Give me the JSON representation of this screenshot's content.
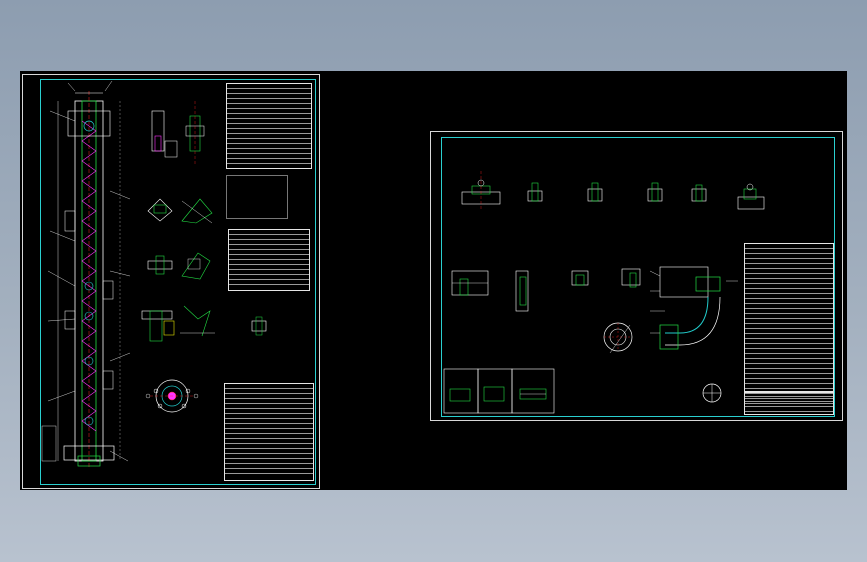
{
  "viewer": {
    "background_top": "#8d9db0",
    "background_bottom": "#b8c2cf",
    "canvas_color": "#000000"
  },
  "colors": {
    "frame": "#2ad0d0",
    "sheet_border": "#d8d8d8",
    "line_white": "#ffffff",
    "line_green": "#22dd44",
    "line_cyan": "#22cccc",
    "line_magenta": "#ff33ff",
    "line_yellow": "#e6e600",
    "line_red": "#ff2222"
  },
  "sheets": [
    {
      "id": "sheet-1",
      "kind": "column-elevation-drawing"
    },
    {
      "id": "sheet-2",
      "kind": "component-detail-drawing"
    }
  ]
}
